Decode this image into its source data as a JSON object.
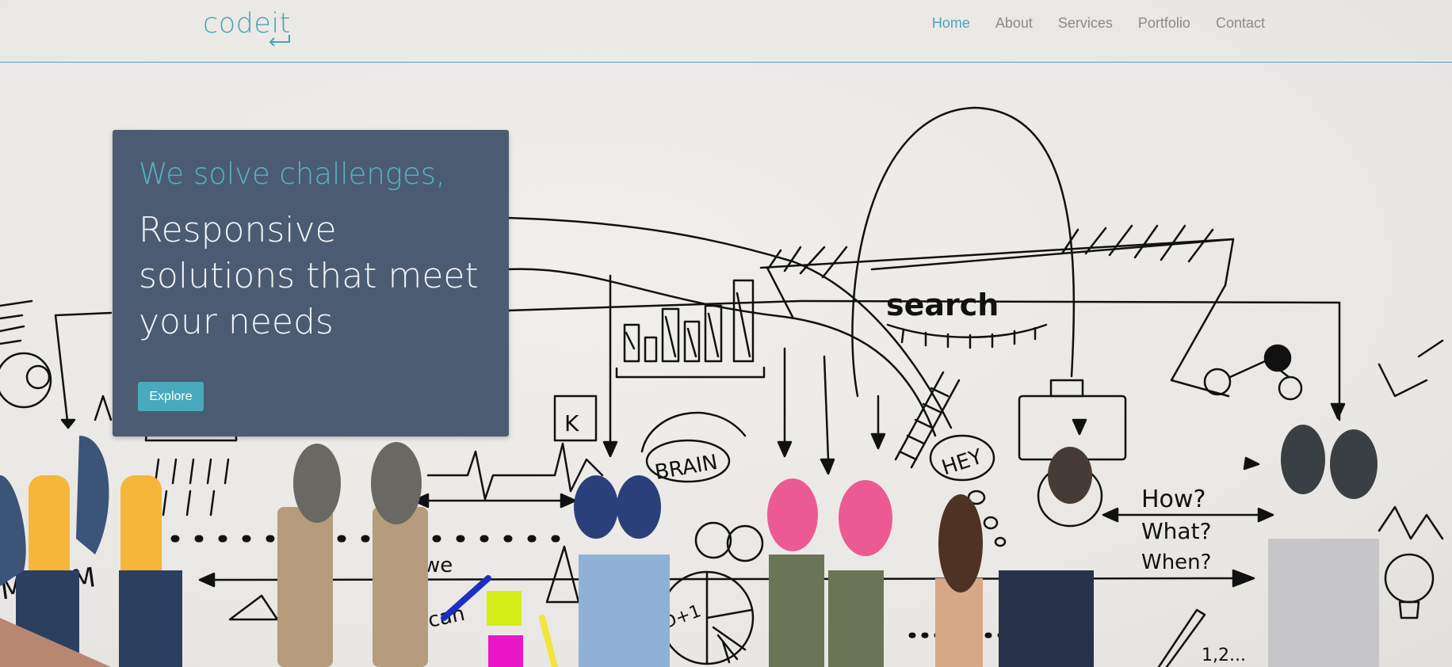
{
  "brand": {
    "name": "codeit"
  },
  "nav": {
    "items": [
      {
        "label": "Home",
        "active": true
      },
      {
        "label": "About",
        "active": false
      },
      {
        "label": "Services",
        "active": false
      },
      {
        "label": "Portfolio",
        "active": false
      },
      {
        "label": "Contact",
        "active": false
      }
    ]
  },
  "hero": {
    "subtitle": "We solve challenges,",
    "title": "Responsive solutions that meet your needs",
    "button_label": "Explore"
  },
  "doodle_words": {
    "search": "search",
    "brain": "BRAIN",
    "hey": "HEY",
    "how": "How?",
    "what": "What?",
    "when": "When?",
    "we": "we",
    "can": "can",
    "k": "K",
    "team": "MKTEM",
    "math": "D+1",
    "seq": "1,2..."
  },
  "colors": {
    "accent": "#4aa6b8",
    "card": "#4b5c72",
    "button": "#48aabd",
    "nav_text": "#8a8a8a"
  }
}
